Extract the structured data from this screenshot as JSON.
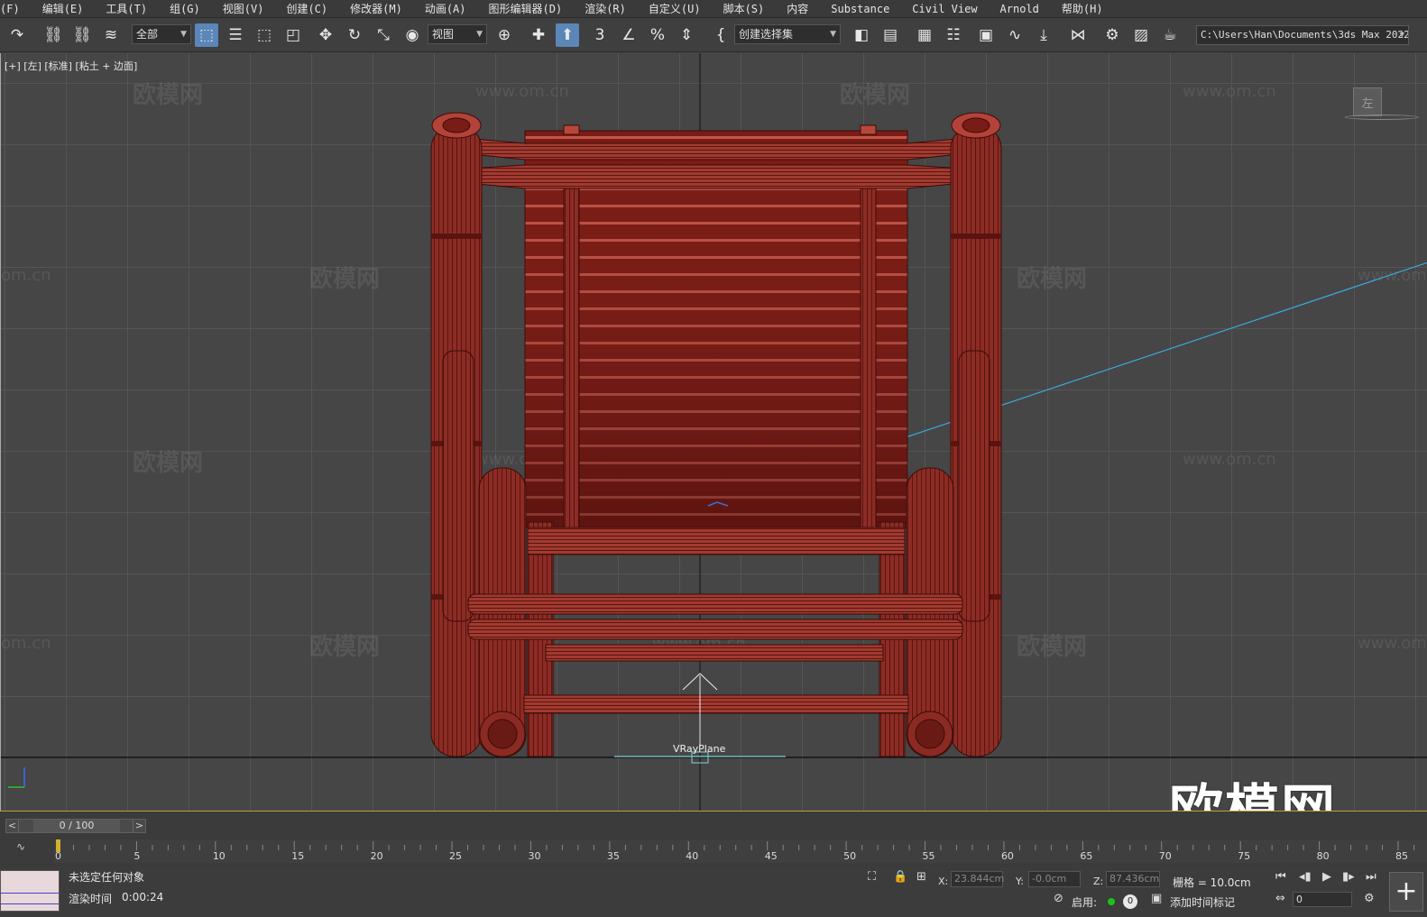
{
  "menu": {
    "items": [
      "(F)",
      "编辑(E)",
      "工具(T)",
      "组(G)",
      "视图(V)",
      "创建(C)",
      "修改器(M)",
      "动画(A)",
      "图形编辑器(D)",
      "渲染(R)",
      "自定义(U)",
      "脚本(S)",
      "内容",
      "Substance",
      "Civil View",
      "Arnold",
      "帮助(H)"
    ]
  },
  "toolbar": {
    "selection_filter": "全部",
    "reference_coord": "视图",
    "named_selection": "创建选择集",
    "project_path": "C:\\Users\\Han\\Documents\\3ds Max 2022",
    "snap_label": "3"
  },
  "viewport": {
    "label": "[+] [左] [标准] [粘土 + 边面]",
    "view_cube_face": "左",
    "object_label": "VRayPlane",
    "watermark_text": "欧模网",
    "watermark_url": "www.om.cn",
    "watermark_url_short": "om.cn",
    "brand_logo": "欧模网"
  },
  "timeline": {
    "current": "0 / 100",
    "prev": "<",
    "next": ">",
    "ticks": [
      "0",
      "5",
      "10",
      "15",
      "20",
      "25",
      "30",
      "35",
      "40",
      "45",
      "50",
      "55",
      "60",
      "65",
      "70",
      "75",
      "80",
      "85"
    ]
  },
  "status": {
    "selection": "未选定任何对象",
    "render_time_label": "渲染时间",
    "render_time": "0:00:24",
    "x_label": "X:",
    "x_value": "23.844cm",
    "y_label": "Y:",
    "y_value": "-0.0cm",
    "z_label": "Z:",
    "z_value": "87.436cm",
    "grid": "栅格 = 10.0cm",
    "enable_label": "启用:",
    "enable_count": "0",
    "add_time_tag": "添加时间标记",
    "frame_value": "0"
  },
  "colors": {
    "chair": "#8b2a22",
    "chair_dark": "#5a1410",
    "accent": "#5a86b8",
    "grid": "#555555",
    "viewport_bg": "#464646"
  }
}
